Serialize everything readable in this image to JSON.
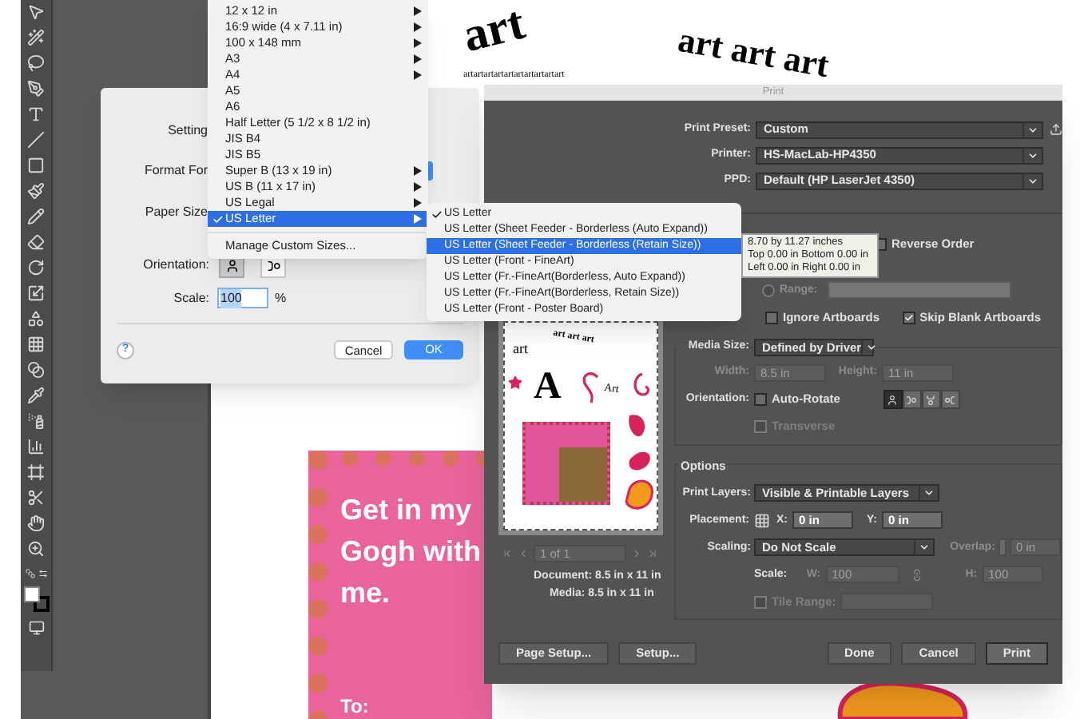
{
  "canvas": {
    "art_big": "art",
    "art_row": "art art art",
    "art_strip": "artartartartartartartartartart",
    "card": {
      "lines": [
        "Get in my",
        "Gogh with",
        "me."
      ],
      "to_label": "To:"
    }
  },
  "page_setup": {
    "settings_label": "Setting",
    "format_label": "Format For",
    "paper_size_label": "Paper Size",
    "orientation_label": "Orientation:",
    "orientations": [
      {
        "selected": true
      },
      {
        "selected": false
      }
    ],
    "scale_label": "Scale:",
    "scale_value": "100",
    "scale_unit": "%",
    "help": "?",
    "buttons": [
      {
        "label": "Cancel",
        "default": false
      },
      {
        "label": "OK",
        "default": true
      }
    ]
  },
  "paper_menu": {
    "items": [
      {
        "label": "12 x 12 in",
        "submenu": true,
        "checked": false,
        "selected": false
      },
      {
        "label": "16:9 wide (4 x 7.11 in)",
        "submenu": true,
        "checked": false,
        "selected": false
      },
      {
        "label": "100 x 148 mm",
        "submenu": true,
        "checked": false,
        "selected": false
      },
      {
        "label": "A3",
        "submenu": true,
        "checked": false,
        "selected": false
      },
      {
        "label": "A4",
        "submenu": true,
        "checked": false,
        "selected": false
      },
      {
        "label": "A5",
        "submenu": false,
        "checked": false,
        "selected": false
      },
      {
        "label": "A6",
        "submenu": false,
        "checked": false,
        "selected": false
      },
      {
        "label": "Half Letter (5 1/2 x 8 1/2 in)",
        "submenu": false,
        "checked": false,
        "selected": false
      },
      {
        "label": "JIS B4",
        "submenu": false,
        "checked": false,
        "selected": false
      },
      {
        "label": "JIS B5",
        "submenu": false,
        "checked": false,
        "selected": false
      },
      {
        "label": "Super B (13 x 19 in)",
        "submenu": true,
        "checked": false,
        "selected": false
      },
      {
        "label": "US B (11 x 17 in)",
        "submenu": true,
        "checked": false,
        "selected": false
      },
      {
        "label": "US Legal",
        "submenu": true,
        "checked": false,
        "selected": false
      },
      {
        "label": "US Letter",
        "submenu": true,
        "checked": true,
        "selected": true
      }
    ],
    "manage": "Manage Custom Sizes..."
  },
  "submenu": {
    "items": [
      {
        "label": "US Letter",
        "checked": true,
        "selected": false
      },
      {
        "label": "US Letter (Sheet Feeder - Borderless (Auto Expand))",
        "checked": false,
        "selected": false
      },
      {
        "label": "US Letter (Sheet Feeder - Borderless (Retain Size))",
        "checked": false,
        "selected": true
      },
      {
        "label": "US Letter (Front - FineArt)",
        "checked": false,
        "selected": false
      },
      {
        "label": "US Letter (Fr.-FineArt(Borderless, Auto Expand))",
        "checked": false,
        "selected": false
      },
      {
        "label": "US Letter (Fr.-FineArt(Borderless, Retain Size))",
        "checked": false,
        "selected": false
      },
      {
        "label": "US Letter (Front - Poster Board)",
        "checked": false,
        "selected": false
      }
    ]
  },
  "tooltip": {
    "lines": [
      "8.70 by 11.27 inches",
      "Top 0.00 in Bottom 0.00 in",
      "Left 0.00 in Right 0.00 in"
    ]
  },
  "print_dialog": {
    "title": "Print",
    "top_rows": [
      {
        "label": "Print Preset:",
        "value": "Custom"
      },
      {
        "label": "Printer:",
        "value": "HS-MacLab-HP4350"
      },
      {
        "label": "PPD:",
        "value": "Default (HP LaserJet 4350)"
      }
    ],
    "reverse_order": {
      "label": "Reverse Order",
      "checked": false
    },
    "range": {
      "label": "Range:",
      "selected": false,
      "disabled": true
    },
    "ignore_artboards": {
      "label": "Ignore Artboards",
      "checked": false
    },
    "skip_blank": {
      "label": "Skip Blank Artboards",
      "checked": true
    },
    "media": {
      "label": "Media Size:",
      "value": "Defined by Driver",
      "width_label": "Width:",
      "width": {
        "value": "8.5 in",
        "disabled": true
      },
      "height_label": "Height:",
      "height": {
        "value": "11 in",
        "disabled": true
      }
    },
    "orientation": {
      "label": "Orientation:",
      "auto_rotate": {
        "label": "Auto-Rotate",
        "checked": false
      },
      "options": [
        {
          "selected": true
        },
        {
          "selected": false
        },
        {
          "selected": false
        },
        {
          "selected": false
        }
      ],
      "transverse": {
        "label": "Transverse",
        "checked": false,
        "disabled": true
      }
    },
    "options": {
      "title": "Options",
      "print_layers_label": "Print Layers:",
      "print_layers": "Visible & Printable Layers",
      "placement_label": "Placement:",
      "x_label": "X:",
      "x": {
        "value": "0 in",
        "disabled": false
      },
      "y_label": "Y:",
      "y": {
        "value": "0 in",
        "disabled": false
      },
      "scaling_label": "Scaling:",
      "scaling": "Do Not Scale",
      "overlap_label": "Overlap:",
      "overlap": {
        "value": "0 in",
        "disabled": true
      },
      "scale_label": "Scale:",
      "w_label": "W:",
      "w": {
        "value": "100",
        "disabled": true
      },
      "h_label": "H:",
      "h": {
        "value": "100",
        "disabled": true
      },
      "tile_range": {
        "label": "Tile Range:",
        "checked": false,
        "disabled": true
      }
    },
    "preview": {
      "texts": {
        "art": "art",
        "art_row": "art art art",
        "letter": "A",
        "art_label": "Art"
      },
      "page_field": {
        "value": "1 of 1",
        "disabled": true
      },
      "document": "Document: 8.5 in x 11 in",
      "media": "Media: 8.5 in x 11 in"
    },
    "left_buttons": [
      "Page Setup...",
      "Setup..."
    ],
    "right_buttons": [
      {
        "label": "Done",
        "default": false
      },
      {
        "label": "Cancel",
        "default": false
      },
      {
        "label": "Print",
        "default": true
      }
    ]
  }
}
